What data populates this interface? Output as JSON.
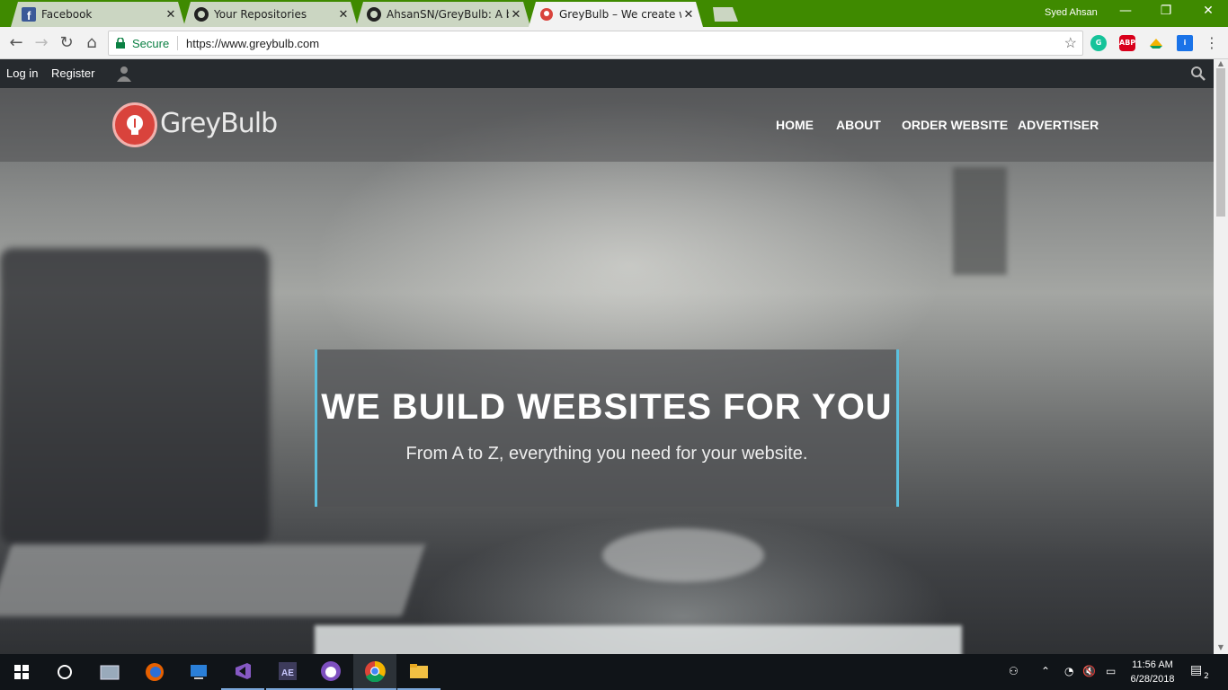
{
  "browser": {
    "tabs": [
      {
        "label": "Facebook",
        "icon": "facebook-icon",
        "color": "#3b5998"
      },
      {
        "label": "Your Repositories",
        "icon": "github-icon"
      },
      {
        "label": "AhsanSN/GreyBulb: A bu",
        "icon": "github-icon"
      },
      {
        "label": "GreyBulb – We create we",
        "icon": "greybulb-icon",
        "color": "#d9433c"
      }
    ],
    "active_tab_index": 3,
    "profile_name": "Syed Ahsan",
    "secure_label": "Secure",
    "url": "https://www.greybulb.com",
    "extensions": [
      {
        "name": "grammarly-icon",
        "color": "#15c39a",
        "text": ""
      },
      {
        "name": "adblock-plus-icon",
        "color": "#d9001b",
        "text": "ABP"
      },
      {
        "name": "drive-icon",
        "color": "#f4b400",
        "text": ""
      },
      {
        "name": "extension-icon",
        "color": "#1a73e8",
        "text": ""
      }
    ]
  },
  "site": {
    "topbar": {
      "login": "Log in",
      "register": "Register"
    },
    "logo": "GreyBulb",
    "nav": [
      "HOME",
      "ABOUT",
      "ORDER WEBSITE",
      "ADVERTISER"
    ],
    "hero_title": "WE BUILD WEBSITES FOR YOU",
    "hero_subtitle": "From A to Z, everything you need for your website.",
    "accent_color": "#5bc0de"
  },
  "taskbar": {
    "time": "11:56 AM",
    "date": "6/28/2018",
    "notification_count": "2"
  }
}
